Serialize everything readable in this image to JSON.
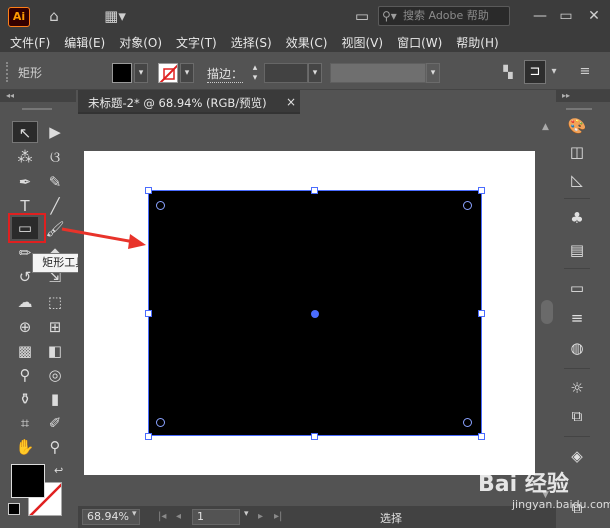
{
  "app": {
    "logo": "Ai",
    "search_placeholder": "搜索 Adobe 帮助"
  },
  "menu": [
    "文件(F)",
    "编辑(E)",
    "对象(O)",
    "文字(T)",
    "选择(S)",
    "效果(C)",
    "视图(V)",
    "窗口(W)",
    "帮助(H)"
  ],
  "control_bar": {
    "tool_name": "矩形",
    "stroke_label": "描边："
  },
  "document": {
    "tab_title": "未标题-2* @ 68.94% (RGB/预览)",
    "close": "×"
  },
  "tooltip": "矩形工具 (M)",
  "status_bar": {
    "zoom": "68.94%",
    "artboard": "1",
    "status": "选择"
  },
  "watermark": {
    "text": "Bai 经验",
    "sub": "jingyan.baidu.com"
  },
  "colors": {
    "fill": "#000000",
    "stroke": "none",
    "accent": "#4a6cff",
    "highlight": "#e02020"
  },
  "icons": {
    "left_tools": [
      "selection-icon",
      "direct-selection-icon",
      "magic-wand-icon",
      "lasso-icon",
      "pen-icon",
      "curvature-icon",
      "type-icon",
      "line-icon",
      "rectangle-icon",
      "paintbrush-icon",
      "shaper-icon",
      "eraser-icon",
      "rotate-icon",
      "scale-icon",
      "warp-icon",
      "free-transform-icon",
      "shape-builder-icon",
      "perspective-icon",
      "mesh-icon",
      "gradient-icon",
      "eyedropper-icon",
      "blend-icon",
      "symbol-sprayer-icon",
      "column-graph-icon",
      "artboard-icon",
      "slice-icon",
      "hand-icon",
      "zoom-icon"
    ],
    "right_panels": [
      "color-icon",
      "color-guide-icon",
      "swatches-icon",
      "brushes-icon",
      "symbols-icon",
      "gradient-panel-icon",
      "stroke-panel-icon",
      "transparency-icon",
      "appearance-icon",
      "graphic-styles-icon",
      "layers-icon",
      "artboards-panel-icon"
    ]
  }
}
